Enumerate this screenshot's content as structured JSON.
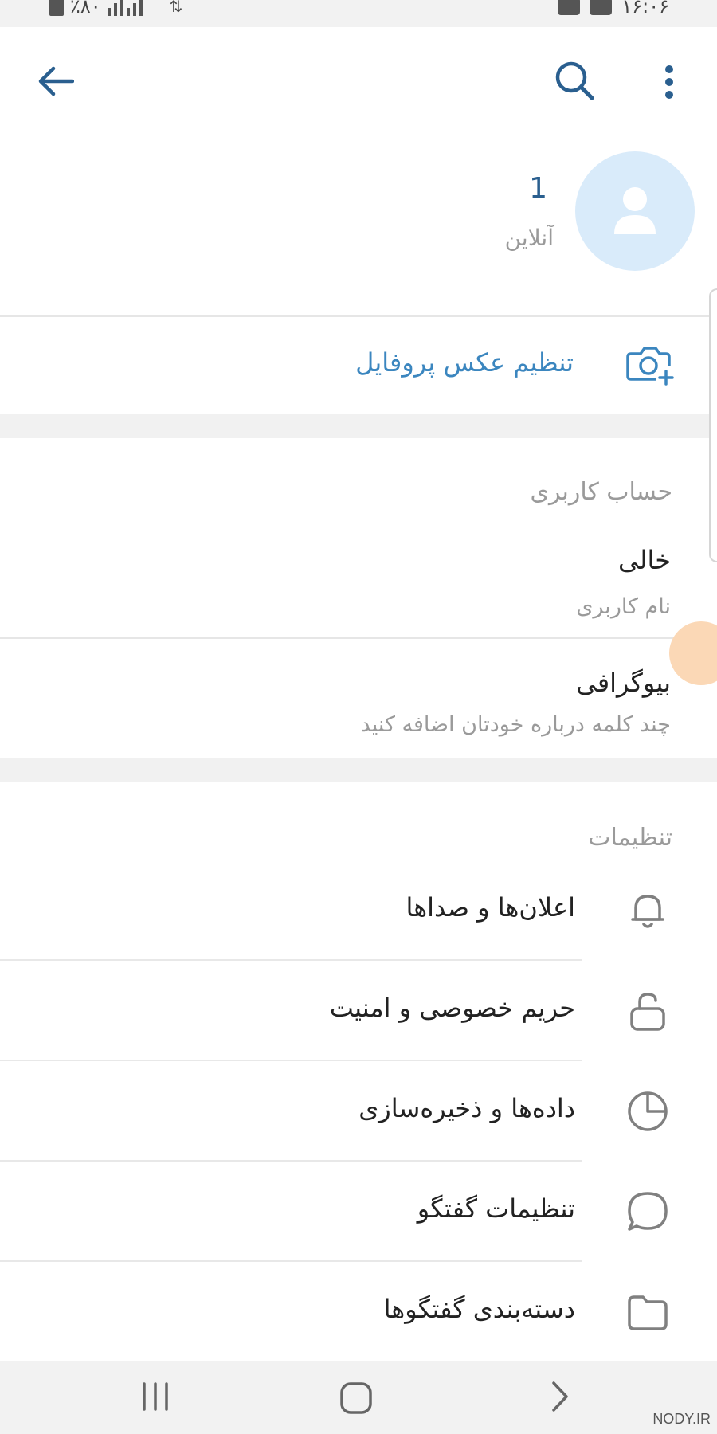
{
  "status_bar": {
    "battery": "٪۸۰",
    "time": "۱۶:۰۶"
  },
  "header": {
    "back_icon": "arrow-back-icon",
    "search_icon": "search-icon",
    "menu_icon": "more-vertical-icon"
  },
  "profile": {
    "name": "1",
    "status": "آنلاین"
  },
  "set_photo": {
    "label": "تنظیم عکس پروفایل",
    "icon": "add-camera-icon"
  },
  "account": {
    "title": "حساب کاربری",
    "username_value": "خالی",
    "username_label": "نام کاربری",
    "bio_label": "بیوگرافی",
    "bio_hint": "چند کلمه درباره خودتان اضافه کنید"
  },
  "settings": {
    "title": "تنظیمات",
    "items": [
      {
        "label": "اعلان‌ها و صداها",
        "icon": "bell-icon"
      },
      {
        "label": "حریم خصوصی و امنیت",
        "icon": "lock-icon"
      },
      {
        "label": "داده‌ها و ذخیره‌سازی",
        "icon": "pie-chart-icon"
      },
      {
        "label": "تنظیمات گفتگو",
        "icon": "chat-bubble-icon"
      },
      {
        "label": "دسته‌بندی گفتگوها",
        "icon": "folder-icon"
      }
    ]
  },
  "watermark": "NODY.IR",
  "colors": {
    "accent": "#3b86bf",
    "header_icon": "#2a5f8f",
    "avatar_bg": "#d9ebfa",
    "muted_text": "#9a9a9a"
  }
}
